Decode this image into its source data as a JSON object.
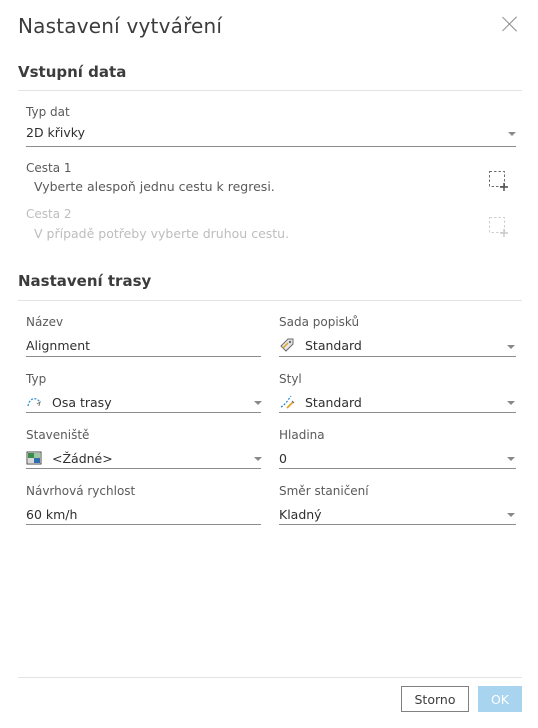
{
  "dialog": {
    "title": "Nastavení vytváření"
  },
  "input_section": {
    "title": "Vstupní data",
    "data_type": {
      "label": "Typ dat",
      "value": "2D křivky"
    },
    "path1": {
      "label": "Cesta 1",
      "hint": "Vyberte alespoň jednu cestu k regresi."
    },
    "path2": {
      "label": "Cesta 2",
      "hint": "V případě potřeby vyberte druhou cestu."
    }
  },
  "route_section": {
    "title": "Nastavení trasy",
    "name": {
      "label": "Název",
      "value": "Alignment"
    },
    "label_set": {
      "label": "Sada popisků",
      "value": "Standard"
    },
    "type": {
      "label": "Typ",
      "value": "Osa trasy"
    },
    "style": {
      "label": "Styl",
      "value": "Standard"
    },
    "site": {
      "label": "Staveniště",
      "value": "<Žádné>"
    },
    "layer": {
      "label": "Hladina",
      "value": "0"
    },
    "design_speed": {
      "label": "Návrhová rychlost",
      "value": "60 km/h"
    },
    "station_direction": {
      "label": "Směr staničení",
      "value": "Kladný"
    }
  },
  "footer": {
    "cancel_label": "Storno",
    "ok_label": "OK"
  },
  "colors": {
    "ok_button": "#a9d4f0",
    "accent_blue": "#2f8fd8"
  },
  "icons": {
    "close": "close-icon",
    "pick": "select-object-icon",
    "label_set": "label-tag-icon",
    "type": "alignment-type-icon",
    "style": "style-icon",
    "site": "site-icon"
  }
}
